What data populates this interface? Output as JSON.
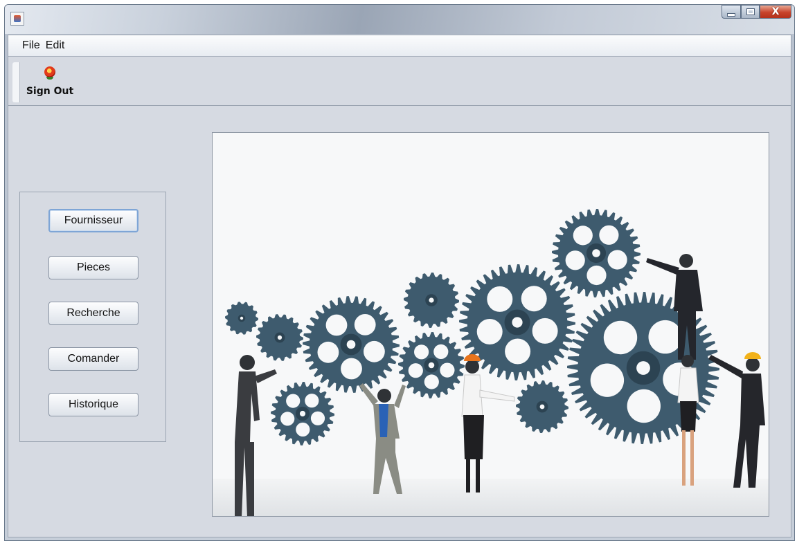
{
  "window": {
    "app_icon": "java-cup-icon",
    "controls": {
      "minimize": "minimize-icon",
      "maximize": "maximize-icon",
      "close_label": "X"
    }
  },
  "menubar": {
    "items": [
      {
        "label": "File"
      },
      {
        "label": "Edit"
      }
    ]
  },
  "toolbar": {
    "signout": {
      "label": "Sign Out",
      "icon": "sign-out-icon"
    }
  },
  "nav": {
    "buttons": [
      {
        "label": "Fournisseur",
        "focused": true
      },
      {
        "label": "Pieces"
      },
      {
        "label": "Recherche"
      },
      {
        "label": "Comander"
      },
      {
        "label": "Historique"
      }
    ]
  },
  "illustration": {
    "subject": "gears-teamwork-image",
    "gear_color": "#3e5b6e"
  }
}
